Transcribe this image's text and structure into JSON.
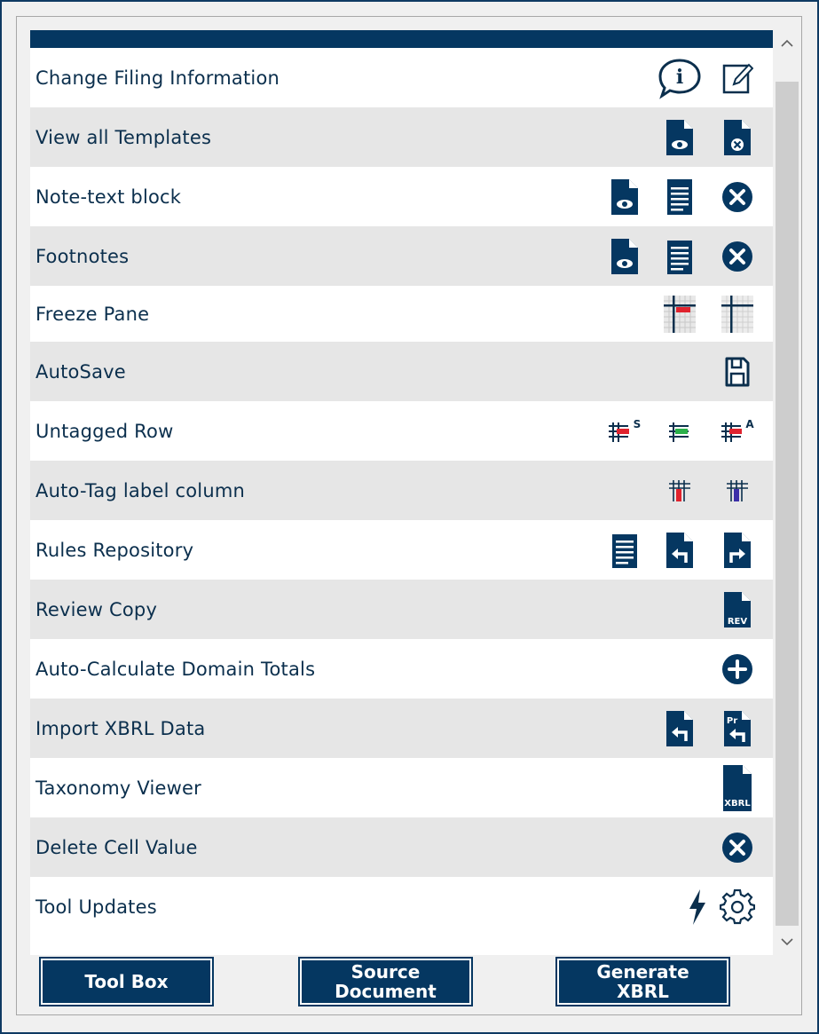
{
  "rows": [
    {
      "label": "Change Filing Information",
      "icons": [
        "info-bubble-icon",
        "edit-icon"
      ]
    },
    {
      "label": "View all Templates",
      "icons": [
        "view-document-icon",
        "remove-document-icon"
      ]
    },
    {
      "label": "Note-text block",
      "icons": [
        "view-document-icon",
        "text-block-icon",
        "delete-circle-icon"
      ]
    },
    {
      "label": "Footnotes",
      "icons": [
        "view-document-icon",
        "text-block-icon",
        "delete-circle-icon"
      ]
    },
    {
      "label": "Freeze Pane",
      "icons": [
        "freeze-pane-icon",
        "unfreeze-pane-icon"
      ]
    },
    {
      "label": "AutoSave",
      "icons": [
        "save-icon"
      ]
    },
    {
      "label": "Untagged Row",
      "icons": [
        "untagged-row-s-icon",
        "untagged-row-icon",
        "untagged-row-a-icon"
      ]
    },
    {
      "label": "Auto-Tag label column",
      "icons": [
        "auto-tag-red-icon",
        "auto-tag-blue-icon"
      ]
    },
    {
      "label": "Rules Repository",
      "icons": [
        "text-block-icon",
        "import-document-icon",
        "export-document-icon"
      ]
    },
    {
      "label": "Review Copy",
      "icons": [
        "review-copy-icon"
      ]
    },
    {
      "label": "Auto-Calculate Domain Totals",
      "icons": [
        "add-circle-icon"
      ]
    },
    {
      "label": "Import XBRL Data",
      "icons": [
        "import-document-icon",
        "import-pr-document-icon"
      ]
    },
    {
      "label": "Taxonomy Viewer",
      "icons": [
        "xbrl-document-icon"
      ]
    },
    {
      "label": "Delete Cell Value",
      "icons": [
        "delete-circle-icon"
      ]
    },
    {
      "label": "Tool Updates",
      "icons": [
        "lightning-icon",
        "gear-icon"
      ]
    }
  ],
  "icon_text": {
    "untagged_s": "S",
    "untagged_a": "A",
    "review": "REV",
    "pr": "Pr",
    "xbrl": "XBRL"
  },
  "buttons": {
    "toolbox": "Tool Box",
    "source_line1": "Source",
    "source_line2": "Document",
    "generate_line1": "Generate",
    "generate_line2": "XBRL"
  },
  "colors": {
    "navy": "#053761",
    "alt_row": "#e6e6e6",
    "label_text": "#0b2f4d"
  }
}
